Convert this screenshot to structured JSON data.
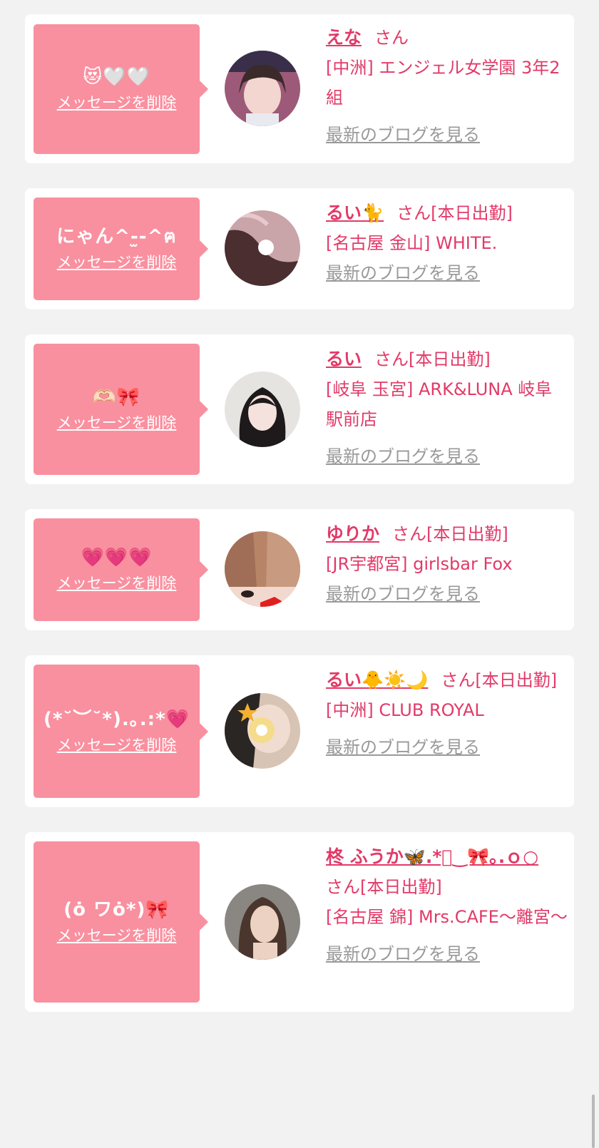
{
  "colors": {
    "background": "#f2f2f2",
    "card": "#ffffff",
    "bubble": "#f9909f",
    "name": "#e23a68",
    "link_gray": "#999999"
  },
  "messages": [
    {
      "message": "😻🤍🤍",
      "delete_label": "メッセージを削除",
      "name": "えな",
      "suffix": "さん",
      "shop": "[中洲] エンジェル女学園 3年2組",
      "blog_label": "最新のブログを見る"
    },
    {
      "message": "にゃん^-̫-^ฅ",
      "delete_label": "メッセージを削除",
      "name": "るい🐈",
      "suffix": "さん[本日出勤]",
      "shop": "[名古屋 金山] WHITE.",
      "blog_label": "最新のブログを見る"
    },
    {
      "message": "🫶🏻🎀",
      "delete_label": "メッセージを削除",
      "name": "るい",
      "suffix": "さん[本日出勤]",
      "shop": "[岐阜 玉宮] ARK&LUNA 岐阜駅前店",
      "blog_label": "最新のブログを見る"
    },
    {
      "message": "💗💗💗",
      "delete_label": "メッセージを削除",
      "name": "ゆりか",
      "suffix": "さん[本日出勤]",
      "shop": "[JR宇都宮] girlsbar Fox",
      "blog_label": "最新のブログを見る"
    },
    {
      "message": "(*˘︶˘*).｡.:*💗",
      "delete_label": "メッセージを削除",
      "name": "るい🐥☀️🌙",
      "suffix": "さん[本日出勤]",
      "shop": "[中洲] CLUB ROYAL",
      "blog_label": "最新のブログを見る"
    },
    {
      "message": "(ȯ ︎ワȯ*)🎀",
      "delete_label": "メッセージを削除",
      "name": "柊 ふうか🦋.*ﾟ‿🎀｡.ｏ○",
      "suffix": "さん[本日出勤]",
      "shop": "[名古屋 錦] Mrs.CAFE〜離宮〜",
      "blog_label": "最新のブログを見る"
    }
  ]
}
